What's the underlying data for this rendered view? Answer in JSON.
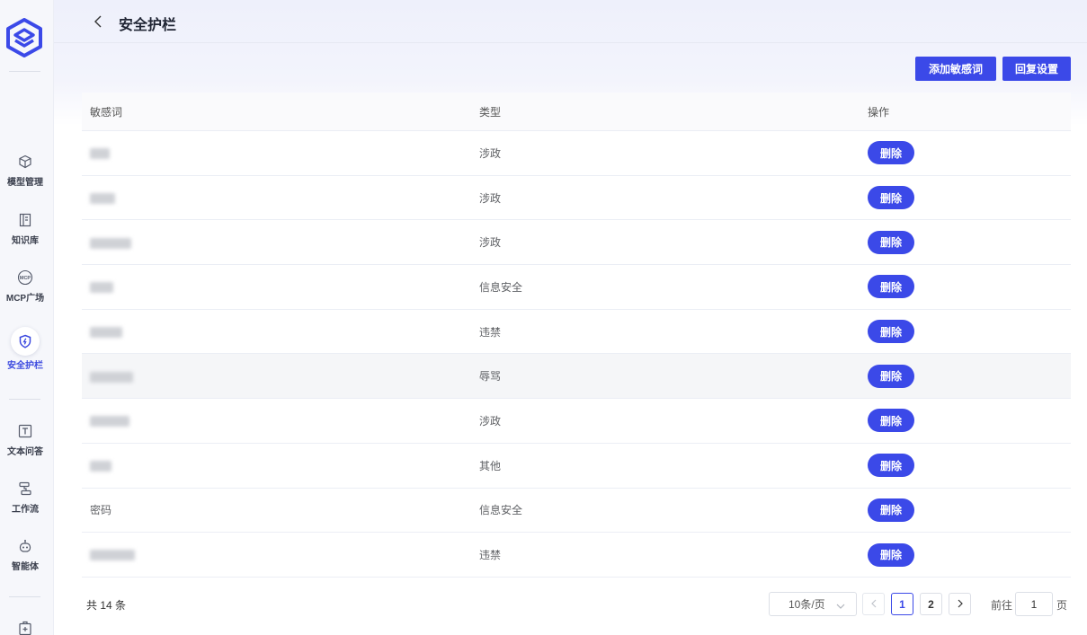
{
  "sidebar": {
    "items": [
      {
        "label": "模型管理",
        "icon": "model-cube-icon"
      },
      {
        "label": "知识库",
        "icon": "knowledge-book-icon"
      },
      {
        "label": "MCP广场",
        "icon": "mcp-icon"
      },
      {
        "label": "安全护栏",
        "icon": "shield-icon",
        "active": true
      },
      {
        "label": "文本问答",
        "icon": "text-qa-icon"
      },
      {
        "label": "工作流",
        "icon": "workflow-icon"
      },
      {
        "label": "智能体",
        "icon": "agent-robot-icon"
      }
    ]
  },
  "header": {
    "title": "安全护栏"
  },
  "actions": {
    "add_label": "添加敏感词",
    "reset_label": "回复设置"
  },
  "table": {
    "columns": [
      "敏感词",
      "类型",
      "操作"
    ],
    "rows": [
      {
        "word": "",
        "type": "涉政",
        "action": "删除"
      },
      {
        "word": "",
        "type": "涉政",
        "action": "删除"
      },
      {
        "word": "",
        "type": "涉政",
        "action": "删除"
      },
      {
        "word": "",
        "type": "信息安全",
        "action": "删除"
      },
      {
        "word": "",
        "type": "违禁",
        "action": "删除"
      },
      {
        "word": "",
        "type": "辱骂",
        "action": "删除"
      },
      {
        "word": "",
        "type": "涉政",
        "action": "删除"
      },
      {
        "word": "",
        "type": "其他",
        "action": "删除"
      },
      {
        "word": "密码",
        "type": "信息安全",
        "action": "删除"
      },
      {
        "word": "",
        "type": "违禁",
        "action": "删除"
      }
    ]
  },
  "pagination": {
    "total_text": "共 14 条",
    "page_size": "10条/页",
    "pages": [
      "1",
      "2"
    ],
    "current_page": "1",
    "goto_label": "前往",
    "goto_value": "1",
    "page_suffix": "页"
  },
  "colors": {
    "accent": "#3b49e8",
    "sidebar_bg": "#f6f7fb"
  }
}
